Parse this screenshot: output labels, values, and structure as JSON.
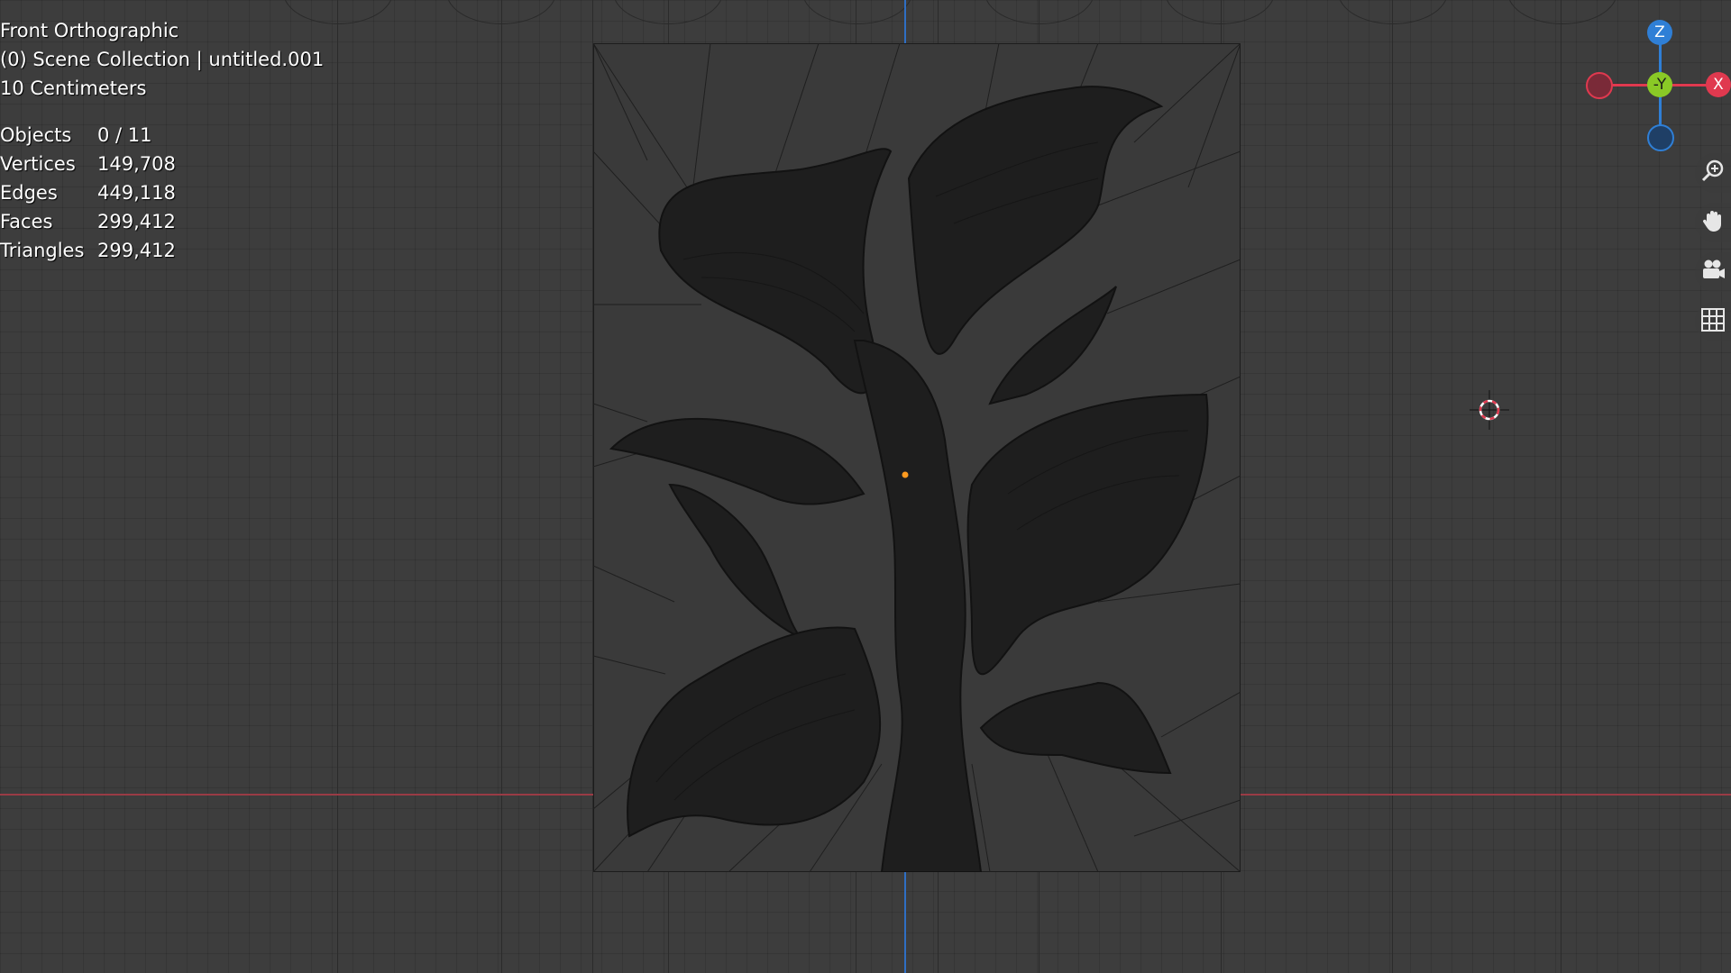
{
  "viewport": {
    "view_name": "Front Orthographic",
    "collection": "(0) Scene Collection | untitled.001",
    "grid_scale": "10 Centimeters"
  },
  "stats": [
    {
      "label": "Objects",
      "value": "0 / 11"
    },
    {
      "label": "Vertices",
      "value": "149,708"
    },
    {
      "label": "Edges",
      "value": "449,118"
    },
    {
      "label": "Faces",
      "value": "299,412"
    },
    {
      "label": "Triangles",
      "value": "299,412"
    }
  ],
  "gizmo": {
    "z_label": "Z",
    "y_label": "-Y",
    "x_label": "X",
    "colors": {
      "x": "#e0394f",
      "y": "#8ac926",
      "z": "#2f7fd6"
    }
  },
  "nav_tools": [
    {
      "name": "zoom",
      "icon": "zoom-in-icon"
    },
    {
      "name": "pan",
      "icon": "hand-icon"
    },
    {
      "name": "camera",
      "icon": "camera-icon"
    },
    {
      "name": "grid",
      "icon": "grid-icon"
    }
  ],
  "colors": {
    "background": "#3d3d3d",
    "x_axis": "#9a3b45",
    "z_axis": "#2f6fc4",
    "mesh": "#1e1e1e",
    "origin": "#ff9a1f"
  }
}
